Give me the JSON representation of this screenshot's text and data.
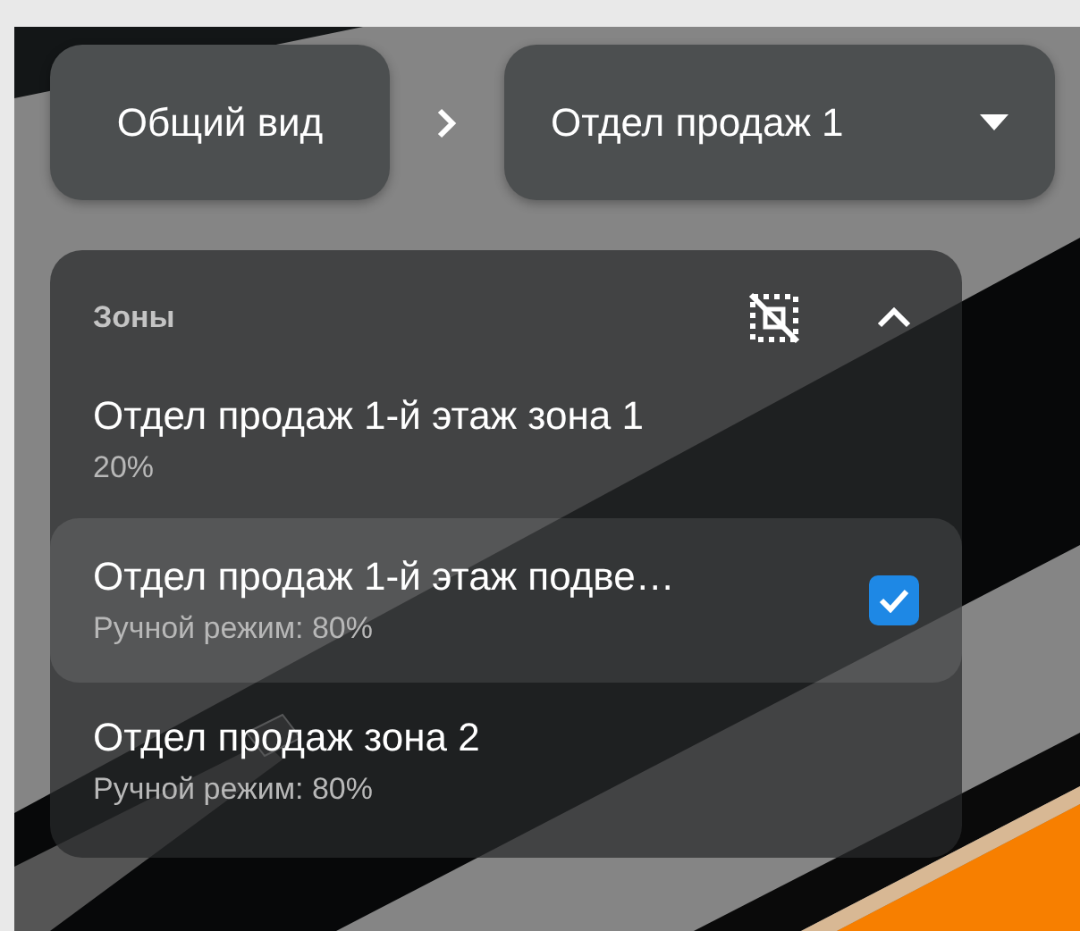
{
  "breadcrumb": {
    "home": "Общий вид",
    "current": "Отдел продаж 1"
  },
  "zones": {
    "title": "Зоны",
    "expanded": true,
    "items": [
      {
        "name": "Отдел продаж 1-й этаж зона 1",
        "detail": "20%",
        "selected": false
      },
      {
        "name": "Отдел продаж 1-й этаж подве…",
        "detail": "Ручной режим: 80%",
        "selected": true
      },
      {
        "name": "Отдел продаж зона 2",
        "detail": "Ручной режим: 80%",
        "selected": false
      }
    ]
  }
}
